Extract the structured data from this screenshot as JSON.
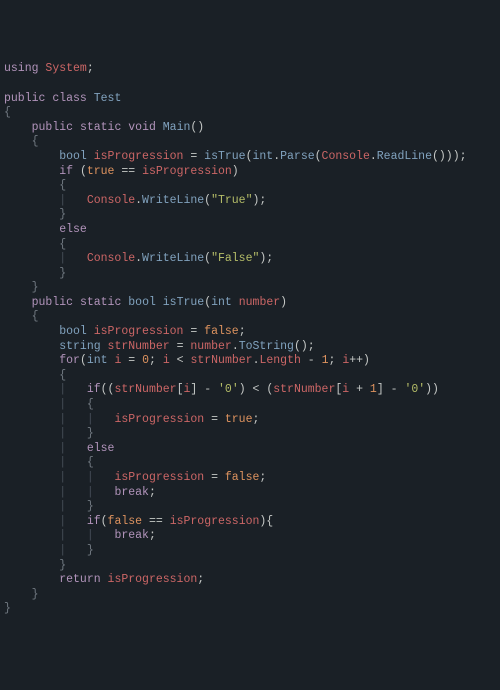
{
  "code": {
    "l1": {
      "kw1": "using",
      "sp": " ",
      "id": "System",
      "p": ";"
    },
    "l3": {
      "kw1": "public",
      "sp": " ",
      "kw2": "class",
      "sp2": " ",
      "name": "Test"
    },
    "l5": {
      "kw1": "public",
      "kw2": "static",
      "kw3": "void",
      "name": "Main"
    },
    "l7": {
      "type": "bool",
      "var": "isProgression",
      "fn": "isTrue",
      "type2": "int",
      "call": "Parse",
      "obj": "Console",
      "call2": "ReadLine"
    },
    "l8": {
      "kw": "if",
      "lit": "true",
      "var": "isProgression"
    },
    "l10": {
      "obj": "Console",
      "call": "WriteLine",
      "str": "\"True\""
    },
    "l12": {
      "kw": "else"
    },
    "l14": {
      "obj": "Console",
      "call": "WriteLine",
      "str": "\"False\""
    },
    "l17": {
      "kw1": "public",
      "kw2": "static",
      "type": "bool",
      "name": "isTrue",
      "ptype": "int",
      "pname": "number"
    },
    "l19": {
      "type": "bool",
      "var": "isProgression",
      "lit": "false"
    },
    "l20": {
      "type": "string",
      "var": "strNumber",
      "obj": "number",
      "call": "ToString"
    },
    "l21": {
      "kw": "for",
      "type": "int",
      "var": "i",
      "n0": "0",
      "var2": "i",
      "obj": "strNumber",
      "prop": "Length",
      "n1": "1",
      "var3": "i"
    },
    "l23": {
      "kw": "if",
      "arr": "strNumber",
      "idx": "i",
      "ch": "'0'",
      "arr2": "strNumber",
      "idx2": "i",
      "n1": "1",
      "ch2": "'0'"
    },
    "l25": {
      "var": "isProgression",
      "lit": "true"
    },
    "l27": {
      "kw": "else"
    },
    "l29": {
      "var": "isProgression",
      "lit": "false"
    },
    "l30": {
      "kw": "break"
    },
    "l32": {
      "kw": "if",
      "lit": "false",
      "var": "isProgression"
    },
    "l33": {
      "kw": "break"
    },
    "l36": {
      "kw": "return",
      "var": "isProgression"
    }
  }
}
